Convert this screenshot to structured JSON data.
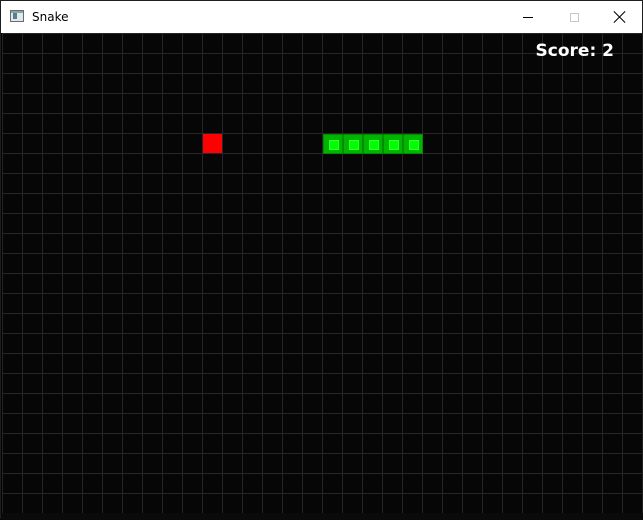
{
  "window": {
    "title": "Snake",
    "app_icon": "window-app-icon",
    "controls": [
      "minimize-icon",
      "maximize-icon",
      "close-icon"
    ],
    "colors": {
      "titlebar": "#ffffff",
      "board_background": "#060606",
      "grid_line": "#262626"
    }
  },
  "game": {
    "score_text": "Score: 2",
    "grid": {
      "columns": 32,
      "rows": 24
    },
    "food": {
      "col": 10,
      "row": 5,
      "color": "#ff0000"
    },
    "snake": {
      "color": "#00ff00",
      "segments": [
        {
          "col": 16,
          "row": 5
        },
        {
          "col": 17,
          "row": 5
        },
        {
          "col": 18,
          "row": 5
        },
        {
          "col": 19,
          "row": 5
        },
        {
          "col": 20,
          "row": 5
        }
      ]
    }
  }
}
